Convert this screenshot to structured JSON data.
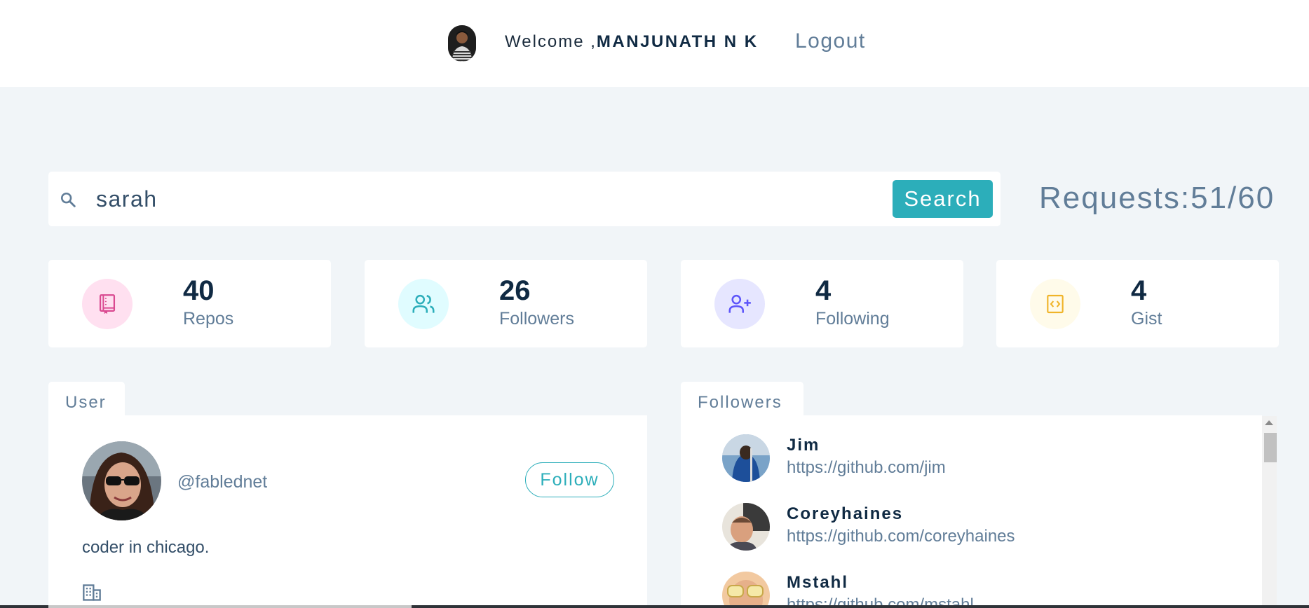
{
  "nav": {
    "welcome_prefix": "Welcome ,",
    "user_name": "MANJUNATH N K",
    "logout_label": "Logout"
  },
  "search": {
    "value": "sarah",
    "placeholder": "",
    "button_label": "Search"
  },
  "requests": {
    "label": "Requests:51/60"
  },
  "stats": [
    {
      "value": "40",
      "label": "Repos",
      "icon": "book-icon",
      "bg": "#ffe0f0",
      "color": "#da4a91"
    },
    {
      "value": "26",
      "label": "Followers",
      "icon": "users-icon",
      "bg": "#e0fcff",
      "color": "#2caeba"
    },
    {
      "value": "4",
      "label": "Following",
      "icon": "user-plus-icon",
      "bg": "#e6e6ff",
      "color": "#5d55fa"
    },
    {
      "value": "4",
      "label": "Gist",
      "icon": "code-icon",
      "bg": "#fffbea",
      "color": "#f0b429"
    }
  ],
  "user_panel": {
    "tab_label": "User",
    "handle": "@fablednet",
    "follow_label": "Follow",
    "bio": "coder in chicago."
  },
  "followers_panel": {
    "tab_label": "Followers",
    "items": [
      {
        "name": "Jim",
        "url": "https://github.com/jim"
      },
      {
        "name": "Coreyhaines",
        "url": "https://github.com/coreyhaines"
      },
      {
        "name": "Mstahl",
        "url": "https://github.com/mstahl"
      }
    ]
  },
  "colors": {
    "accent": "#2caeba",
    "background": "#f1f5f8",
    "text_dark": "#102a43",
    "text_muted": "#617d98"
  }
}
